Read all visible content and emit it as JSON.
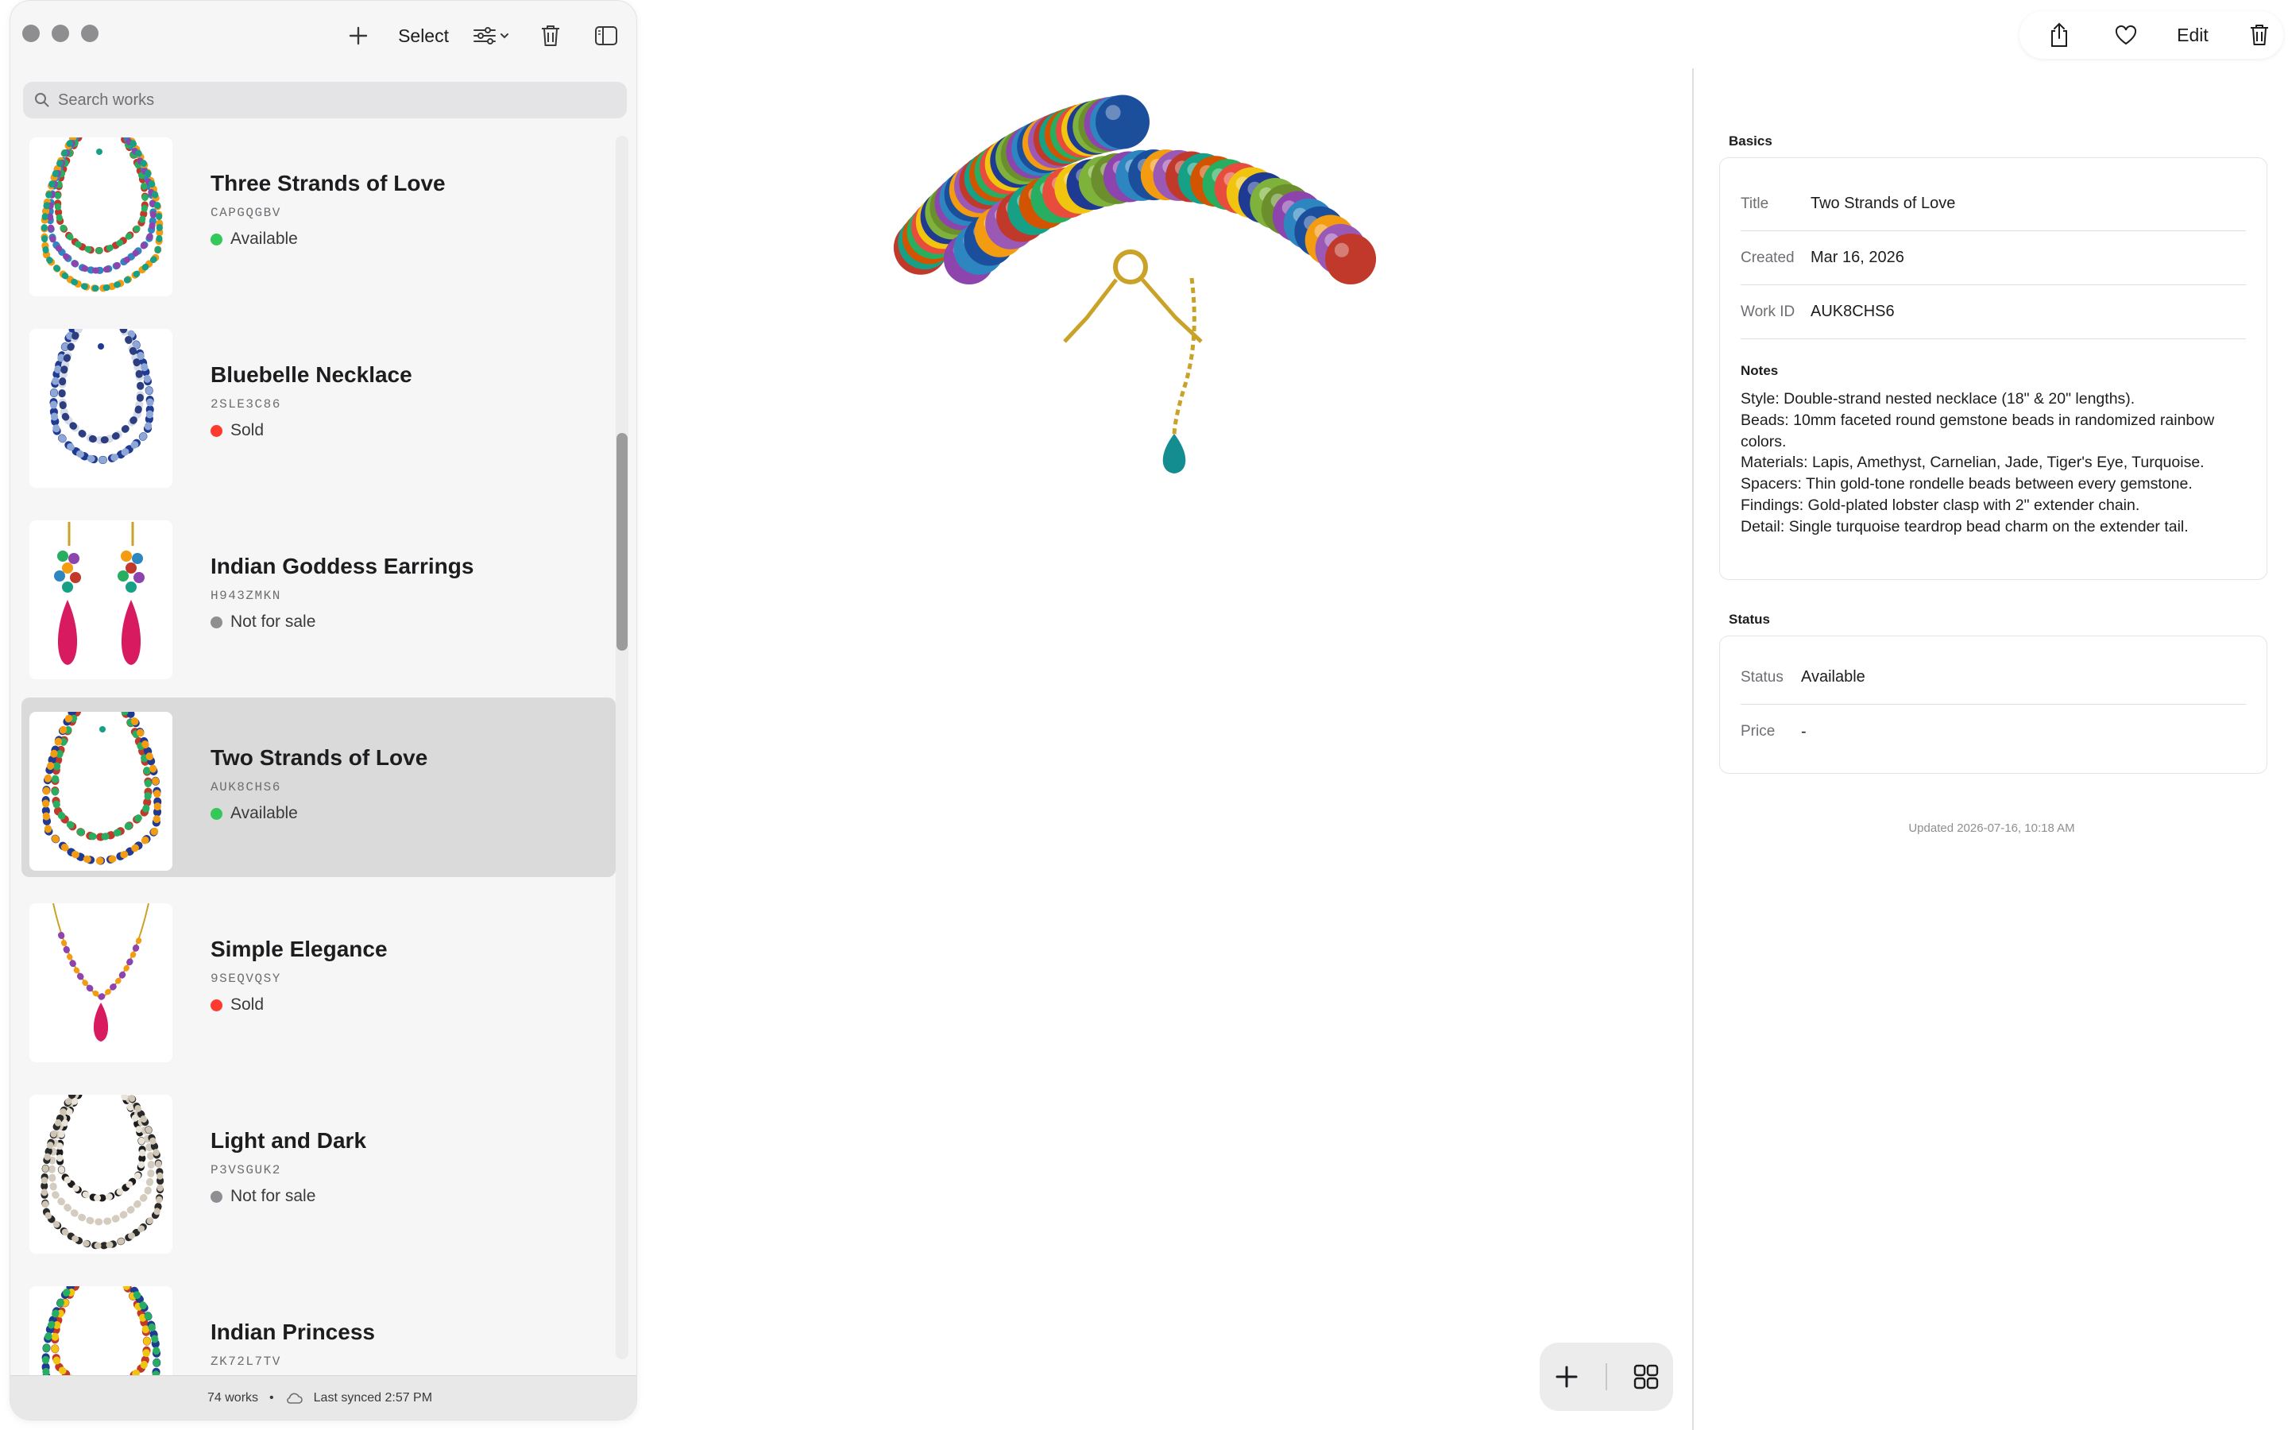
{
  "sidebar": {
    "toolbar": {
      "select_label": "Select"
    },
    "search": {
      "placeholder": "Search works"
    },
    "items": [
      {
        "title": "Three Strands of Love",
        "id": "CAPGQGBV",
        "status": "Available",
        "status_color": "#34c759"
      },
      {
        "title": "Bluebelle Necklace",
        "id": "2SLE3C86",
        "status": "Sold",
        "status_color": "#ff3b30"
      },
      {
        "title": "Indian Goddess Earrings",
        "id": "H943ZMKN",
        "status": "Not for sale",
        "status_color": "#8e8e93"
      },
      {
        "title": "Two Strands of Love",
        "id": "AUK8CHS6",
        "status": "Available",
        "status_color": "#34c759"
      },
      {
        "title": "Simple Elegance",
        "id": "9SEQVQSY",
        "status": "Sold",
        "status_color": "#ff3b30"
      },
      {
        "title": "Light and Dark",
        "id": "P3VSGUK2",
        "status": "Not for sale",
        "status_color": "#8e8e93"
      },
      {
        "title": "Indian Princess",
        "id": "ZK72L7TV",
        "status": "",
        "status_color": "#8e8e93"
      }
    ],
    "selected_index": 3,
    "footer": {
      "count": "74 works",
      "separator": "•",
      "sync": "Last synced 2:57 PM"
    }
  },
  "toolbar_right": {
    "edit_label": "Edit"
  },
  "inspector": {
    "basics_head": "Basics",
    "title_label": "Title",
    "title_value": "Two Strands of Love",
    "created_label": "Created",
    "created_value": "Mar 16, 2026",
    "workid_label": "Work ID",
    "workid_value": "AUK8CHS6",
    "notes_head": "Notes",
    "notes": [
      "Style: Double-strand nested necklace (18\" & 20\" lengths).",
      "Beads: 10mm faceted round gemstone beads in randomized rainbow colors.",
      "Materials: Lapis, Amethyst, Carnelian, Jade, Tiger's Eye, Turquoise.",
      "Spacers: Thin gold-tone rondelle beads between every gemstone.",
      "Findings: Gold-plated lobster clasp with 2\" extender chain.",
      "Detail: Single turquoise teardrop bead charm on the extender tail."
    ],
    "status_head": "Status",
    "status_label": "Status",
    "status_value": "Available",
    "price_label": "Price",
    "price_value": "-",
    "updated": "Updated 2026-07-16, 10:18 AM"
  },
  "icons": [
    "plus-icon",
    "filter-icon",
    "trash-icon",
    "sidebar-icon",
    "search-icon",
    "cloud-icon",
    "share-icon",
    "heart-icon",
    "grid-icon"
  ]
}
